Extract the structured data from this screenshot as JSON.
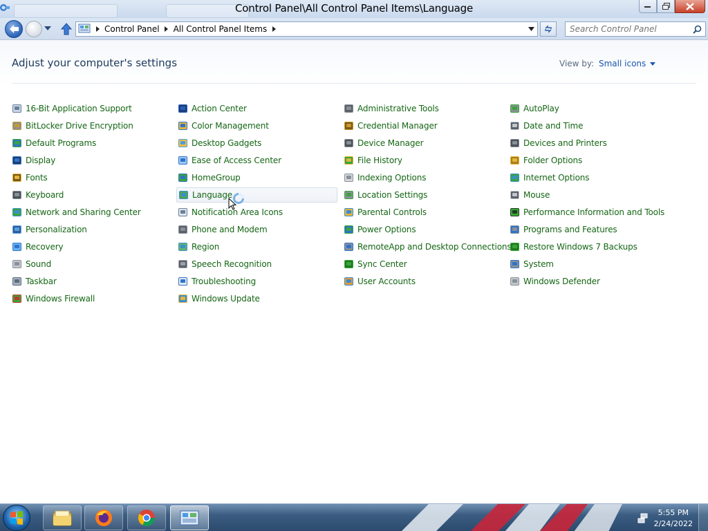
{
  "window": {
    "title": "Control Panel\\All Control Panel Items\\Language"
  },
  "address": {
    "crumbs": [
      "Control Panel",
      "All Control Panel Items"
    ],
    "search_placeholder": "Search Control Panel"
  },
  "header": {
    "heading": "Adjust your computer's settings",
    "view_by_label": "View by:",
    "view_mode": "Small icons"
  },
  "columns": [
    [
      {
        "label": "16-Bit Application Support",
        "icon": "application-icon"
      },
      {
        "label": "BitLocker Drive Encryption",
        "icon": "bitlocker-icon"
      },
      {
        "label": "Default Programs",
        "icon": "default-programs-icon"
      },
      {
        "label": "Display",
        "icon": "display-icon"
      },
      {
        "label": "Fonts",
        "icon": "fonts-icon"
      },
      {
        "label": "Keyboard",
        "icon": "keyboard-icon"
      },
      {
        "label": "Network and Sharing Center",
        "icon": "network-icon"
      },
      {
        "label": "Personalization",
        "icon": "personalization-icon"
      },
      {
        "label": "Recovery",
        "icon": "recovery-icon"
      },
      {
        "label": "Sound",
        "icon": "sound-icon"
      },
      {
        "label": "Taskbar",
        "icon": "taskbar-icon"
      },
      {
        "label": "Windows Firewall",
        "icon": "firewall-icon"
      }
    ],
    [
      {
        "label": "Action Center",
        "icon": "flag-icon"
      },
      {
        "label": "Color Management",
        "icon": "color-management-icon"
      },
      {
        "label": "Desktop Gadgets",
        "icon": "gadgets-icon"
      },
      {
        "label": "Ease of Access Center",
        "icon": "ease-of-access-icon"
      },
      {
        "label": "HomeGroup",
        "icon": "homegroup-icon"
      },
      {
        "label": "Language",
        "icon": "language-icon"
      },
      {
        "label": "Notification Area Icons",
        "icon": "notification-icon"
      },
      {
        "label": "Phone and Modem",
        "icon": "phone-icon"
      },
      {
        "label": "Region",
        "icon": "region-icon"
      },
      {
        "label": "Speech Recognition",
        "icon": "microphone-icon"
      },
      {
        "label": "Troubleshooting",
        "icon": "troubleshooting-icon"
      },
      {
        "label": "Windows Update",
        "icon": "windows-update-icon"
      }
    ],
    [
      {
        "label": "Administrative Tools",
        "icon": "admin-tools-icon"
      },
      {
        "label": "Credential Manager",
        "icon": "credential-icon"
      },
      {
        "label": "Device Manager",
        "icon": "device-manager-icon"
      },
      {
        "label": "File History",
        "icon": "file-history-icon"
      },
      {
        "label": "Indexing Options",
        "icon": "indexing-icon"
      },
      {
        "label": "Location Settings",
        "icon": "location-icon"
      },
      {
        "label": "Parental Controls",
        "icon": "parental-controls-icon"
      },
      {
        "label": "Power Options",
        "icon": "power-icon"
      },
      {
        "label": "RemoteApp and Desktop Connections",
        "icon": "remoteapp-icon"
      },
      {
        "label": "Sync Center",
        "icon": "sync-icon"
      },
      {
        "label": "User Accounts",
        "icon": "users-icon"
      }
    ],
    [
      {
        "label": "AutoPlay",
        "icon": "autoplay-icon"
      },
      {
        "label": "Date and Time",
        "icon": "clock-icon"
      },
      {
        "label": "Devices and Printers",
        "icon": "printer-icon"
      },
      {
        "label": "Folder Options",
        "icon": "folder-icon"
      },
      {
        "label": "Internet Options",
        "icon": "globe-icon"
      },
      {
        "label": "Mouse",
        "icon": "mouse-icon"
      },
      {
        "label": "Performance Information and Tools",
        "icon": "performance-icon"
      },
      {
        "label": "Programs and Features",
        "icon": "programs-icon"
      },
      {
        "label": "Restore Windows 7 Backups",
        "icon": "backup-icon"
      },
      {
        "label": "System",
        "icon": "system-icon"
      },
      {
        "label": "Windows Defender",
        "icon": "defender-icon"
      }
    ]
  ],
  "hovered_item": "Language",
  "taskbar": {
    "apps": [
      "file-explorer-icon",
      "firefox-icon",
      "chrome-icon",
      "control-panel-icon"
    ],
    "clock_time": "5:55 PM",
    "clock_date": "2/24/2022"
  },
  "colors": {
    "link_green": "#156615",
    "heading_blue": "#1e395b",
    "accent_blue": "#1a55b0"
  }
}
